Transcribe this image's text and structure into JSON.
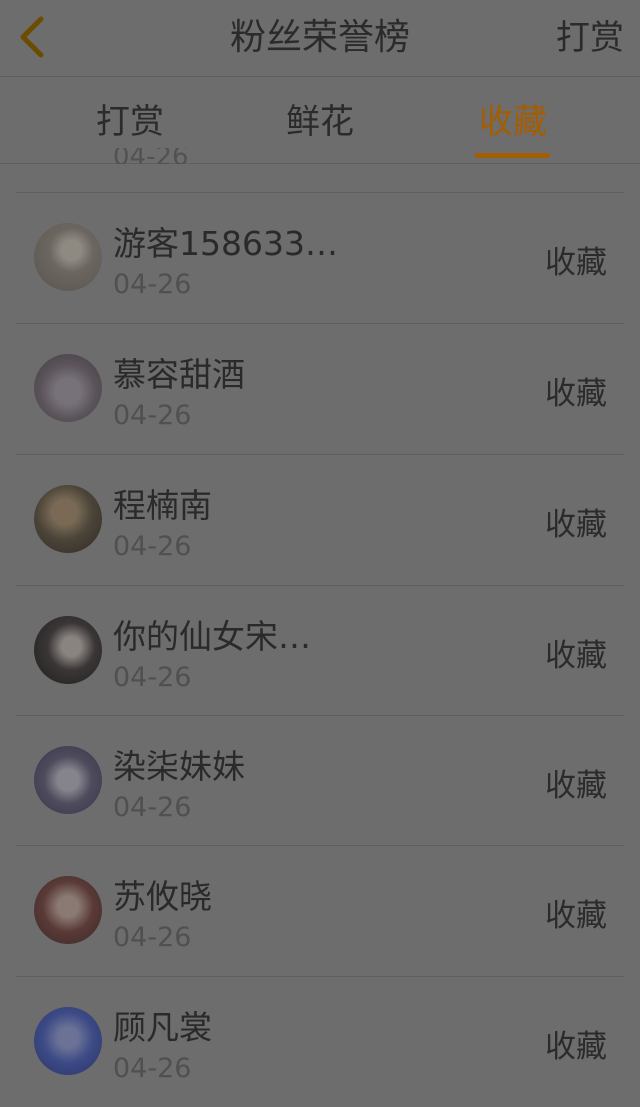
{
  "header": {
    "title": "粉丝荣誉榜",
    "action_label": "打赏"
  },
  "tabs": [
    {
      "label": "打赏"
    },
    {
      "label": "鲜花"
    },
    {
      "label": "收藏"
    }
  ],
  "active_tab": "收藏",
  "colors": {
    "accent": "#a45d00",
    "background": "#6d6d6d"
  },
  "peek_date": "04-26",
  "rows": [
    {
      "name": "游客158633…",
      "date": "04-26",
      "type": "收藏"
    },
    {
      "name": "慕容甜酒",
      "date": "04-26",
      "type": "收藏"
    },
    {
      "name": "程楠南",
      "date": "04-26",
      "type": "收藏"
    },
    {
      "name": "你的仙女宋…",
      "date": "04-26",
      "type": "收藏"
    },
    {
      "name": "染柒妹妹",
      "date": "04-26",
      "type": "收藏"
    },
    {
      "name": "苏攸晓",
      "date": "04-26",
      "type": "收藏"
    },
    {
      "name": "顾凡裳",
      "date": "04-26",
      "type": "收藏"
    }
  ]
}
